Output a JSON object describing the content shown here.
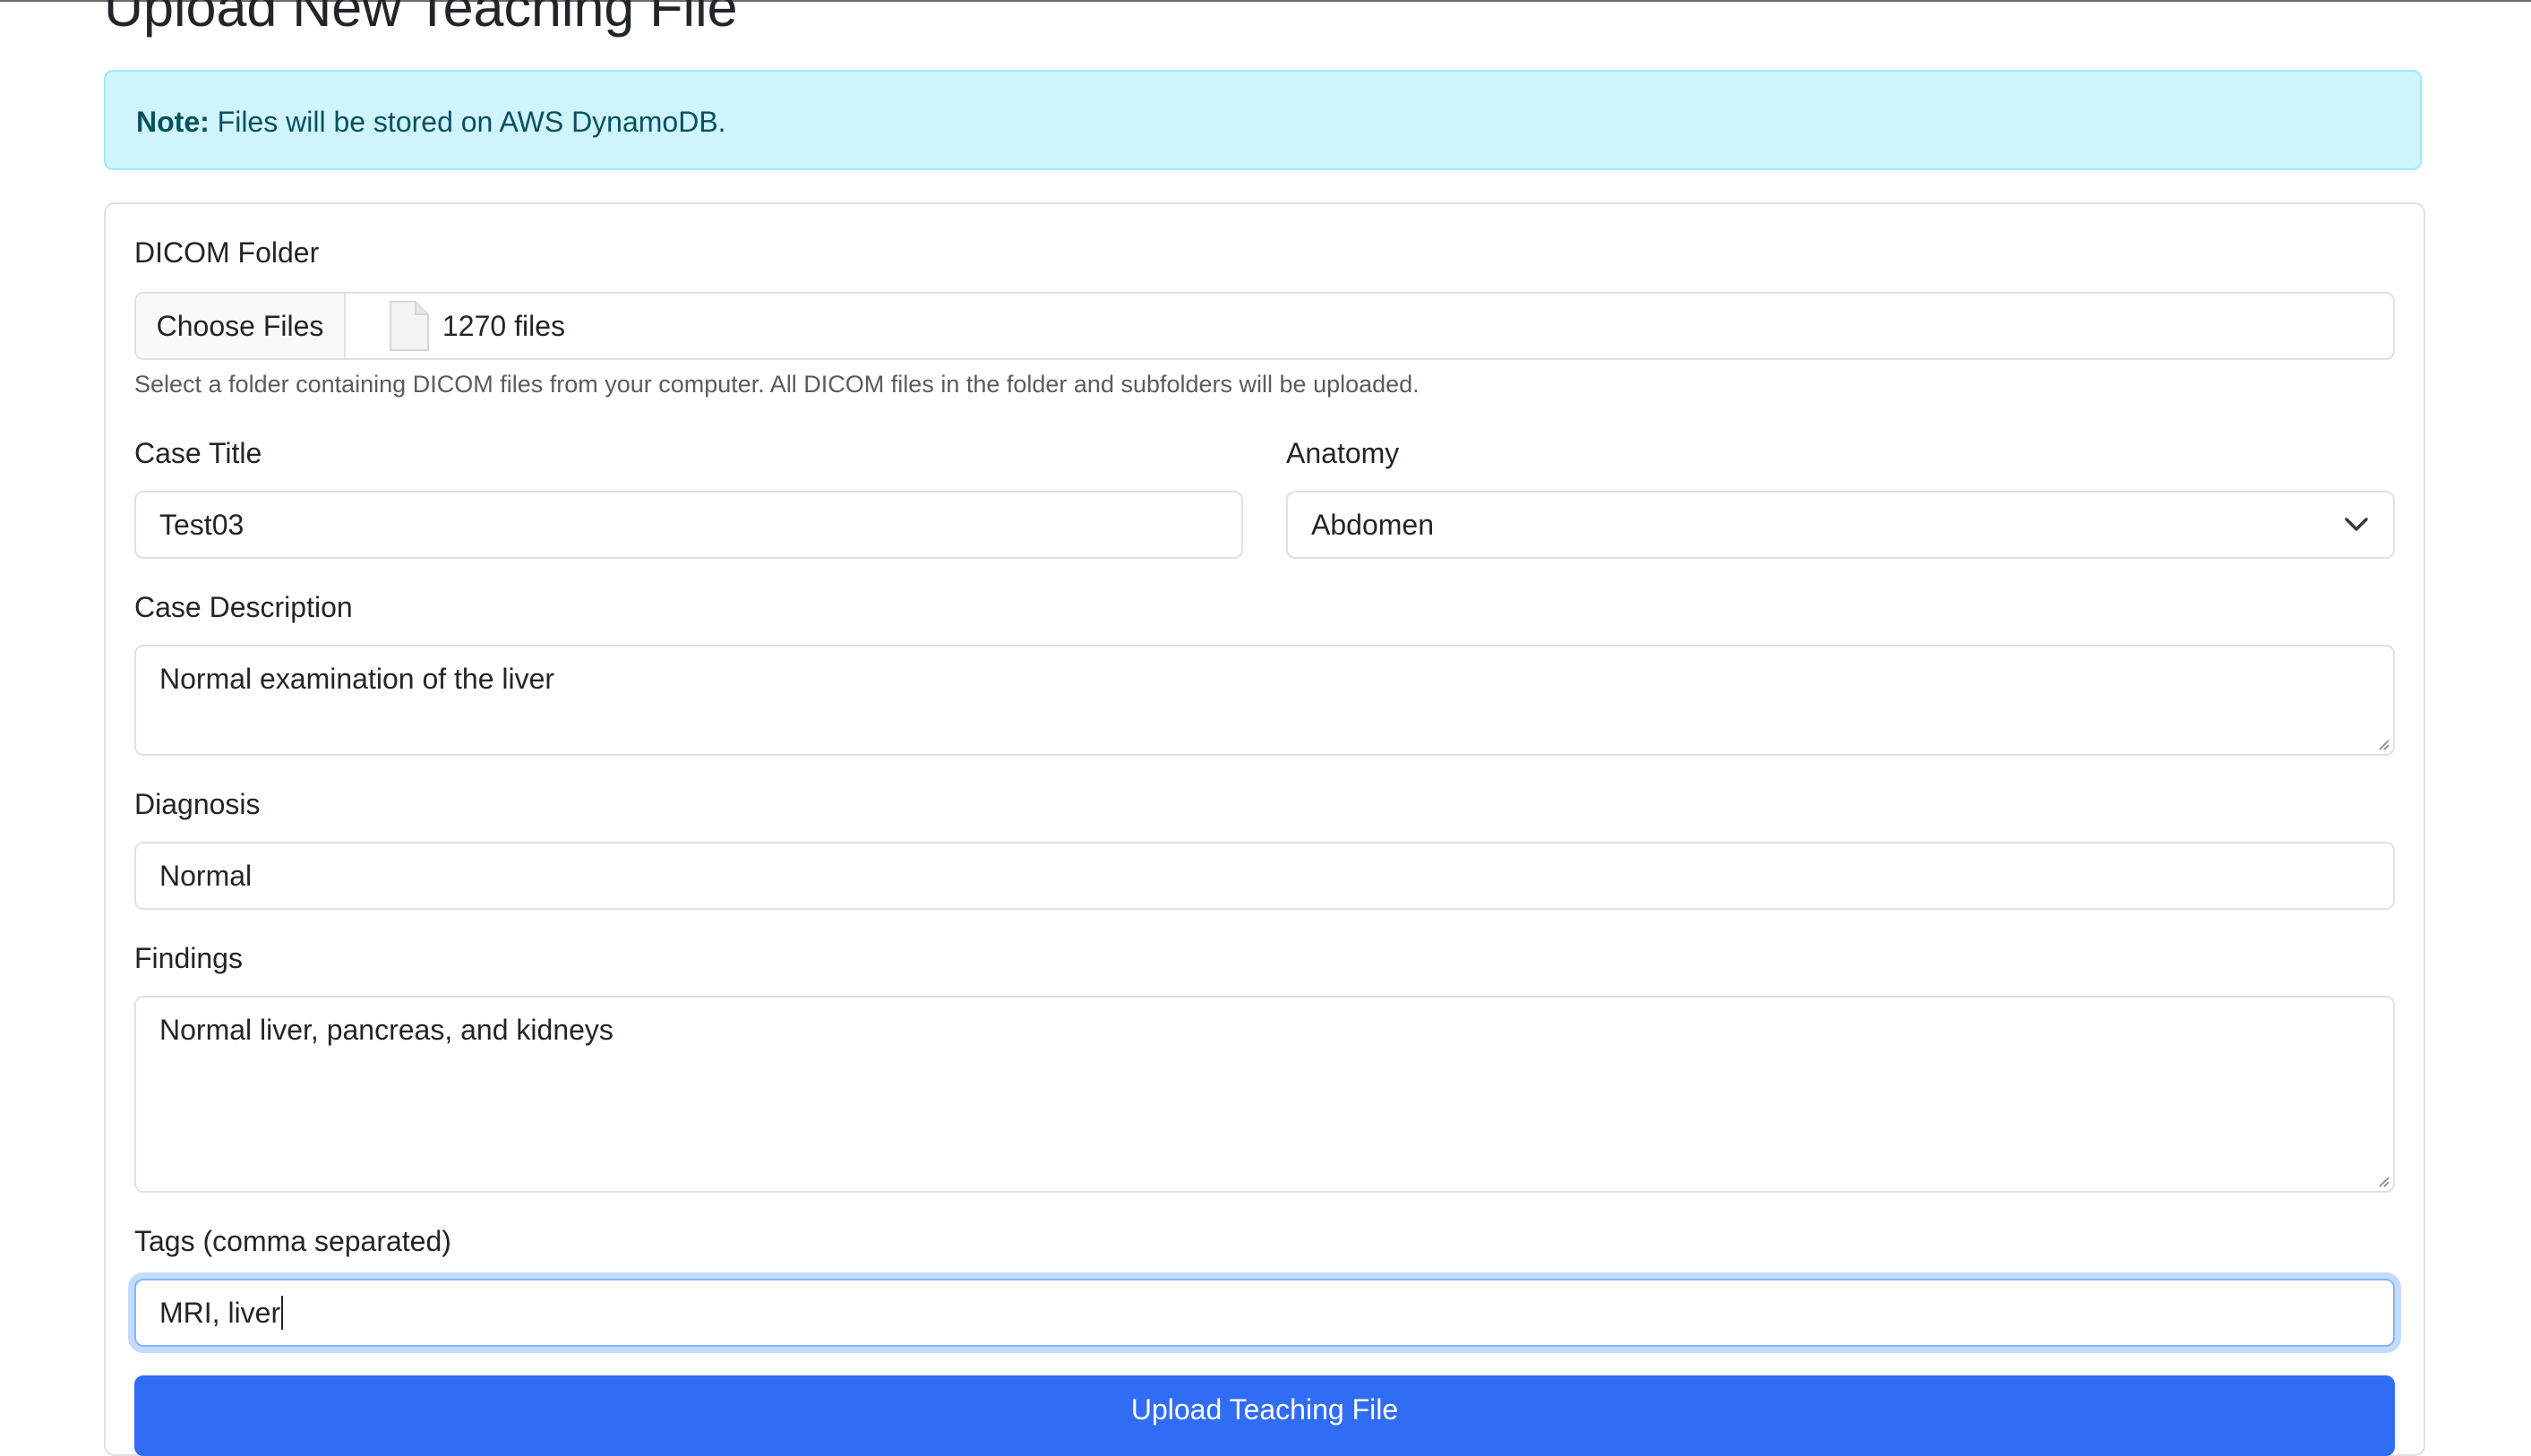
{
  "page": {
    "title": "Upload New Teaching File"
  },
  "alert": {
    "strong": "Note:",
    "text": " Files will be stored on AWS DynamoDB."
  },
  "form": {
    "dicom": {
      "label": "DICOM Folder",
      "button": "Choose Files",
      "file_count": "1270 files",
      "help": "Select a folder containing DICOM files from your computer. All DICOM files in the folder and subfolders will be uploaded."
    },
    "case_title": {
      "label": "Case Title",
      "value": "Test03"
    },
    "anatomy": {
      "label": "Anatomy",
      "selected": "Abdomen"
    },
    "case_description": {
      "label": "Case Description",
      "value": "Normal examination of the liver"
    },
    "diagnosis": {
      "label": "Diagnosis",
      "value": "Normal"
    },
    "findings": {
      "label": "Findings",
      "value": "Normal liver, pancreas, and kidneys"
    },
    "tags": {
      "label": "Tags (comma separated)",
      "value": "MRI, liver"
    },
    "submit_label": "Upload Teaching File"
  },
  "colors": {
    "primary": "#316cf4",
    "alert_bg": "#cff4fc",
    "alert_text": "#055160"
  },
  "icons": {
    "file": "file-icon",
    "chevron": "chevron-down-icon"
  }
}
